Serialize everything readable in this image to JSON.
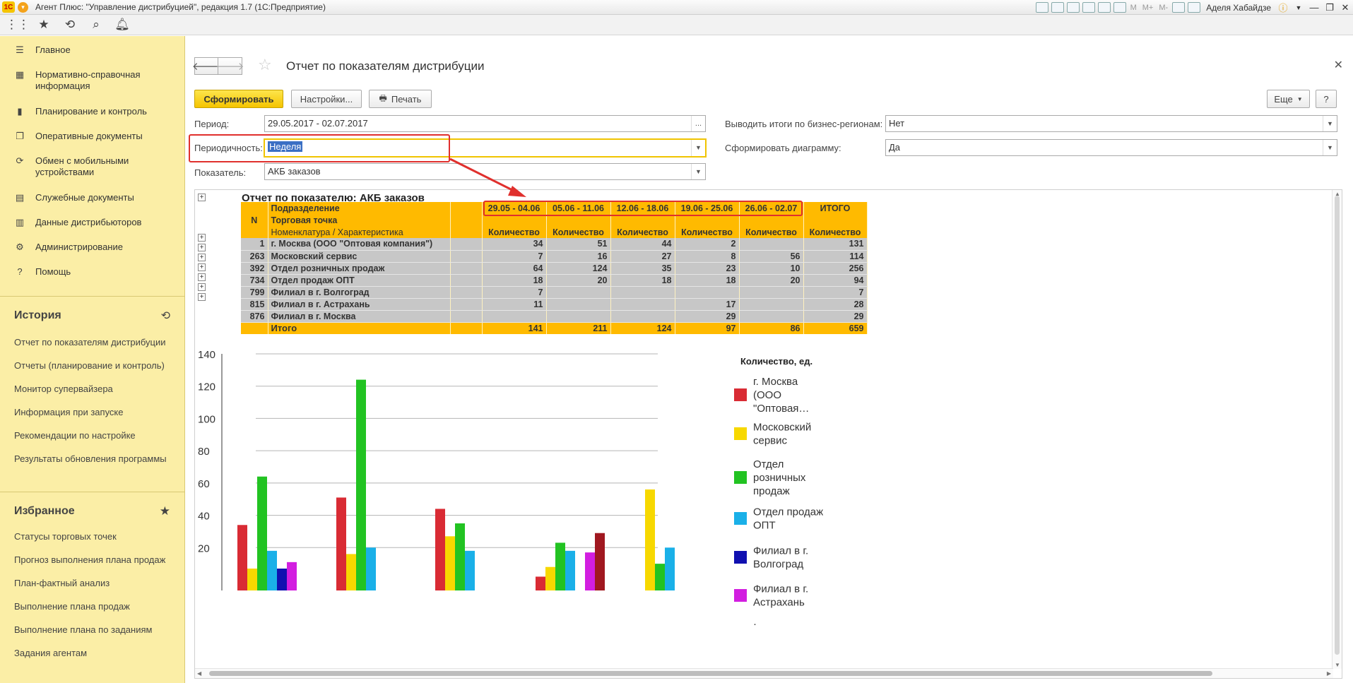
{
  "window": {
    "title": "Агент Плюс: \"Управление дистрибуцией\", редакция 1.7 (1С:Предприятие)",
    "user": "Аделя Хабайдзе",
    "tools": [
      "M",
      "M+",
      "M-"
    ]
  },
  "sidebar": {
    "items": [
      {
        "label": "Главное",
        "icon": "menu-icon"
      },
      {
        "label": "Нормативно-справочная информация",
        "icon": "catalog-icon"
      },
      {
        "label": "Планирование и контроль",
        "icon": "chart-icon"
      },
      {
        "label": "Оперативные документы",
        "icon": "documents-icon"
      },
      {
        "label": "Обмен с мобильными устройствами",
        "icon": "sync-icon"
      },
      {
        "label": "Служебные документы",
        "icon": "service-docs-icon"
      },
      {
        "label": "Данные дистрибьюторов",
        "icon": "distributor-data-icon"
      },
      {
        "label": "Администрирование",
        "icon": "gear-icon"
      },
      {
        "label": "Помощь",
        "icon": "help-icon"
      }
    ],
    "history_title": "История",
    "history": [
      "Отчет по показателям дистрибуции",
      "Отчеты (планирование и контроль)",
      "Монитор супервайзера",
      "Информация при запуске",
      "Рекомендации по настройке",
      "Результаты обновления программы"
    ],
    "favorites_title": "Избранное",
    "favorites": [
      "Статусы торговых точек",
      "Прогноз выполнения плана продаж",
      "План-фактный анализ",
      "Выполнение плана продаж",
      "Выполнение плана по заданиям",
      "Задания агентам"
    ]
  },
  "form": {
    "title": "Отчет по показателям дистрибуции",
    "generate_label": "Сформировать",
    "settings_label": "Настройки...",
    "print_label": "Печать",
    "more_label": "Еще",
    "help_label": "?",
    "period_label": "Период:",
    "period_value": "29.05.2017 - 02.07.2017",
    "period_btn": "...",
    "periodicity_label": "Периодичность:",
    "periodicity_value": "Неделя",
    "indicator_label": "Показатель:",
    "indicator_value": "АКБ заказов",
    "regions_label": "Выводить итоги по бизнес-регионам:",
    "regions_value": "Нет",
    "diagram_label": "Сформировать диаграмму:",
    "diagram_value": "Да"
  },
  "report": {
    "title": "Отчет по показателю: АКБ заказов",
    "head": {
      "n": "N",
      "dept": "Подразделение",
      "outlet": "Торговая точка",
      "nomen": "Номенклатура / Характеристика",
      "weeks": [
        "29.05 - 04.06",
        "05.06 - 11.06",
        "12.06 - 18.06",
        "19.06 - 25.06",
        "26.06 - 02.07"
      ],
      "total": "ИТОГО",
      "qty": "Количество"
    },
    "rows": [
      {
        "n": "1",
        "name": "г. Москва  (ООО \"Оптовая компания\")",
        "v": [
          "34",
          "51",
          "44",
          "2",
          ""
        ],
        "total": "131"
      },
      {
        "n": "263",
        "name": "Московский сервис",
        "v": [
          "7",
          "16",
          "27",
          "8",
          "56"
        ],
        "total": "114"
      },
      {
        "n": "392",
        "name": "Отдел розничных продаж",
        "v": [
          "64",
          "124",
          "35",
          "23",
          "10"
        ],
        "total": "256"
      },
      {
        "n": "734",
        "name": "Отдел продаж ОПТ",
        "v": [
          "18",
          "20",
          "18",
          "18",
          "20"
        ],
        "total": "94"
      },
      {
        "n": "799",
        "name": "Филиал в г. Волгоград",
        "v": [
          "7",
          "",
          "",
          "",
          ""
        ],
        "total": "7"
      },
      {
        "n": "815",
        "name": "Филиал в г. Астрахань",
        "v": [
          "11",
          "",
          "",
          "17",
          ""
        ],
        "total": "28"
      },
      {
        "n": "876",
        "name": "Филиал в г. Москва",
        "v": [
          "",
          "",
          "",
          "29",
          ""
        ],
        "total": "29"
      }
    ],
    "total_row": {
      "label": "Итого",
      "v": [
        "141",
        "211",
        "124",
        "97",
        "86"
      ],
      "total": "659"
    }
  },
  "chart_data": {
    "type": "bar",
    "categories": [
      "29.05 - 04.06",
      "05.06 - 11.06",
      "12.06 - 18.06",
      "19.06 - 25.06",
      "26.06 - 02.07"
    ],
    "legend_title": "Количество, ед.",
    "ylim": [
      0,
      140
    ],
    "yticks": [
      20,
      40,
      60,
      80,
      100,
      120,
      140
    ],
    "grid": true,
    "legend": "right",
    "series": [
      {
        "name": "г. Москва  (ООО \"Оптовая…",
        "color": "#d92b34",
        "values": [
          34,
          51,
          44,
          2,
          0
        ]
      },
      {
        "name": "Московский сервис",
        "color": "#f7d800",
        "values": [
          7,
          16,
          27,
          8,
          56
        ]
      },
      {
        "name": "Отдел розничных продаж",
        "color": "#22c322",
        "values": [
          64,
          124,
          35,
          23,
          10
        ]
      },
      {
        "name": "Отдел продаж ОПТ",
        "color": "#1ab0e8",
        "values": [
          18,
          20,
          18,
          18,
          20
        ]
      },
      {
        "name": "Филиал в г. Волгоград",
        "color": "#1010b0",
        "values": [
          7,
          0,
          0,
          0,
          0
        ]
      },
      {
        "name": "Филиал в г. Астрахань",
        "color": "#d21ee0",
        "values": [
          11,
          0,
          0,
          17,
          0
        ]
      },
      {
        "name": "Филиал в г. Москва",
        "color": "#a01820",
        "values": [
          0,
          0,
          0,
          29,
          0
        ]
      }
    ]
  }
}
